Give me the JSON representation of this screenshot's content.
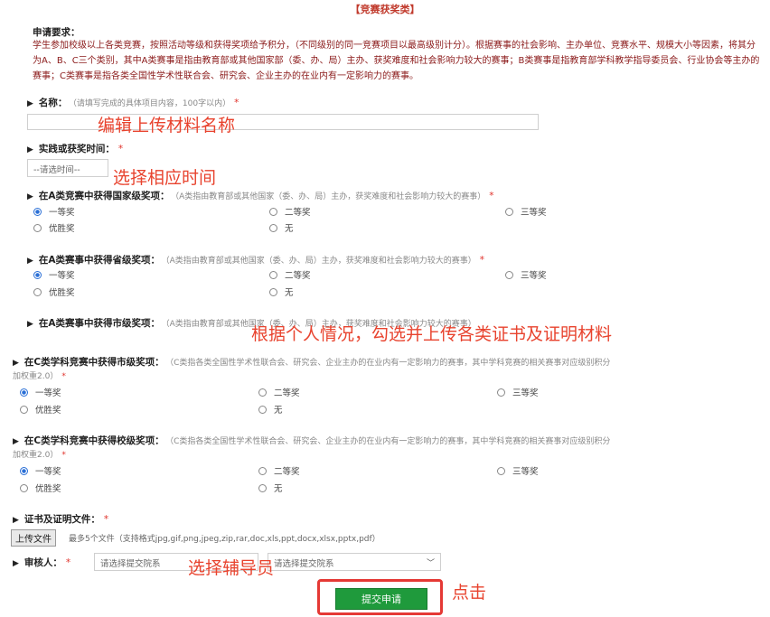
{
  "header": {
    "title": "【竞赛获奖类】"
  },
  "requirements": {
    "title": "申请要求：",
    "text": "学生参加校级以上各类竞赛，按照活动等级和获得奖项给予积分，（不同级别的同一竞赛项目以最高级别计分）。根据赛事的社会影响、主办单位、竞赛水平、规模大小等因素，将其分为A、B、C三个类别，其中A类赛事是指由教育部或其他国家部（委、办、局）主办、获奖难度和社会影响力较大的赛事；B类赛事是指教育部学科教学指导委员会、行业协会等主办的赛事；C类赛事是指各类全国性学术性联合会、研究会、企业主办的在业内有一定影响力的赛事。"
  },
  "required_mark": "*",
  "name_field": {
    "label": "名称：",
    "hint": "（请填写完成的具体项目内容，100字以内）",
    "value": ""
  },
  "time_field": {
    "label": "实践或获奖时间：",
    "placeholder": "--请选时间--"
  },
  "awards": {
    "options": [
      "一等奖",
      "二等奖",
      "三等奖",
      "优胜奖",
      "无"
    ],
    "a_national": {
      "label": "在A类竞赛中获得国家级奖项：",
      "hint": "（A类指由教育部或其他国家（委、办、局）主办，获奖难度和社会影响力较大的赛事）"
    },
    "a_provincial": {
      "label": "在A类赛事中获得省级奖项：",
      "hint": "（A类指由教育部或其他国家（委、办、局）主办，获奖难度和社会影响力较大的赛事）"
    },
    "a_city": {
      "label": "在A类赛事中获得市级奖项：",
      "hint": "（A类指由教育部或其他国家（委、办、局）主办，获奖难度和社会影响力较大的赛事）"
    },
    "c_city": {
      "label": "在C类学科竞赛中获得市级奖项：",
      "hint": "（C类指各类全国性学术性联合会、研究会、企业主办的在业内有一定影响力的赛事，其中学科竞赛的相关赛事对应级别积分",
      "hint2": "加权重2.0）"
    },
    "c_school": {
      "label": "在C类学科竞赛中获得校级奖项：",
      "hint": "（C类指各类全国性学术性联合会、研究会、企业主办的在业内有一定影响力的赛事，其中学科竞赛的相关赛事对应级别积分",
      "hint2": "加权重2.0）"
    }
  },
  "files": {
    "label": "证书及证明文件：",
    "button": "上传文件",
    "hint": "最多5个文件（支持格式jpg,gif,png,jpeg,zip,rar,doc,xls,ppt,docx,xlsx,pptx,pdf）"
  },
  "reviewer": {
    "label": "审核人：",
    "select1": "请选择提交院系",
    "select2": "请选择提交院系"
  },
  "submit": {
    "label": "提交申请"
  },
  "annotations": {
    "name": "编辑上传材料名称",
    "time": "选择相应时间",
    "awards": "根据个人情况，勾选并上传各类证书及证明材料",
    "reviewer": "选择辅导员",
    "click": "点击"
  },
  "colors": {
    "annotation": "#e8432e",
    "submit": "#1f9a3c",
    "requirement_text": "#8b1a1a",
    "radio_selected": "#2a6fd6"
  }
}
